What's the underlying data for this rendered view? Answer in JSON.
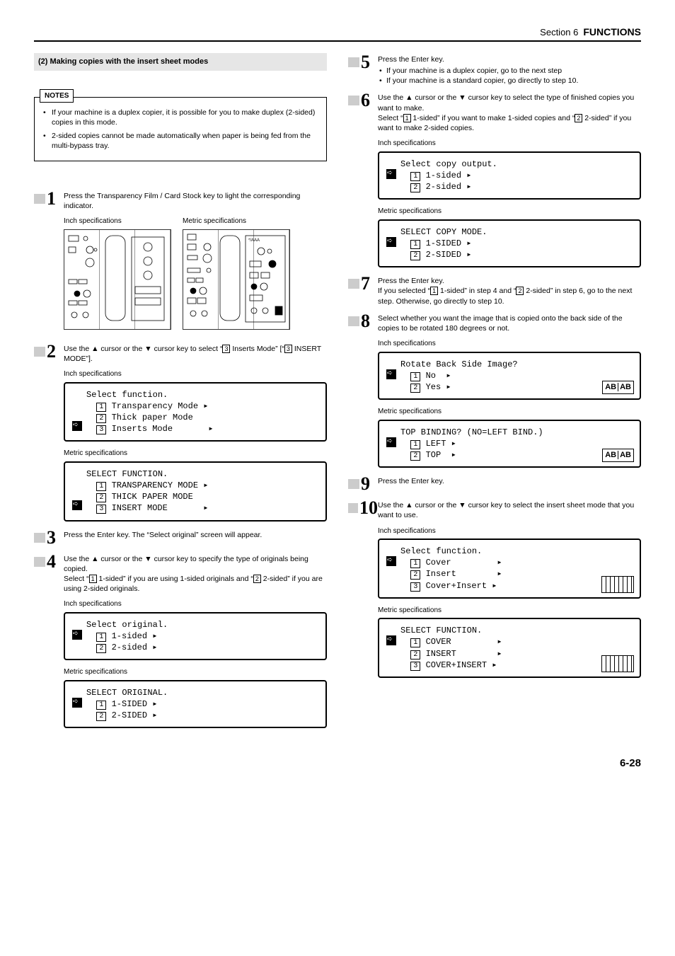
{
  "header": {
    "section": "Section 6",
    "title": "FUNCTIONS"
  },
  "subtitle": "(2) Making copies with the insert sheet modes",
  "notes": {
    "label": "NOTES",
    "items": [
      "If your machine is a duplex copier, it is possible for you to make duplex (2-sided) copies in this mode.",
      "2-sided copies cannot be made automatically when paper is being fed from the multi-bypass tray."
    ]
  },
  "panel_captions": {
    "inch": "Inch specifications",
    "metric": "Metric specifications"
  },
  "steps": {
    "s1": "Press the Transparency Film / Card Stock key to light the corresponding indicator.",
    "s2": {
      "pre": "Use the ▲ cursor or the ▼ cursor key to select “",
      "opt": "3",
      "post": " Inserts Mode” [“",
      "opt2": "3",
      "post2": " INSERT MODE”]."
    },
    "s3": "Press the Enter key. The “Select original” screen will appear.",
    "s4": {
      "line1": "Use the ▲ cursor or the ▼ cursor key to specify the type of originals being copied.",
      "line2a": "Select “",
      "o1": "1",
      "line2b": " 1-sided” if you are using 1-sided originals and “",
      "o2": "2",
      "line2c": " 2-sided” if you are using 2-sided originals."
    },
    "s5": {
      "line1": "Press the Enter key.",
      "b1": "If your machine is a duplex copier, go to the next step",
      "b2": "If your machine is a standard copier, go directly to step 10."
    },
    "s6": {
      "line1": "Use the ▲ cursor or the ▼ cursor key to select the type of finished copies you want to make.",
      "line2a": "Select “",
      "o1": "1",
      "line2b": " 1-sided” if you want to make 1-sided copies and “",
      "o2": "2",
      "line2c": " 2-sided” if you want to make 2-sided copies."
    },
    "s7": {
      "line1": "Press the Enter key.",
      "line2a": "If you selected “",
      "o1": "1",
      "line2b": " 1-sided” in step 4 and “",
      "o2": "2",
      "line2c": " 2-sided” in step 6, go to the next step. Otherwise, go directly to step 10."
    },
    "s8": "Select whether you want the image that is copied onto the back side of the copies to be rotated 180 degrees or not.",
    "s9": "Press the Enter key.",
    "s10": "Use the ▲ cursor or the ▼ cursor key to select the insert sheet mode that you want to use."
  },
  "lcd": {
    "s2_inch": {
      "title": "Select function.",
      "l1": "Transparency Mode ▸",
      "l2": "Thick paper Mode",
      "l3": "Inserts Mode       ▸"
    },
    "s2_metric": {
      "title": "SELECT FUNCTION.",
      "l1": "TRANSPARENCY MODE ▸",
      "l2": "THICK PAPER MODE",
      "l3": "INSERT MODE       ▸"
    },
    "s4_inch": {
      "title": "Select original.",
      "l1": "1-sided ▸",
      "l2": "2-sided ▸"
    },
    "s4_metric": {
      "title": "SELECT ORIGINAL.",
      "l1": "1-SIDED ▸",
      "l2": "2-SIDED ▸"
    },
    "s6_inch": {
      "title": "Select copy output.",
      "l1": "1-sided ▸",
      "l2": "2-sided ▸"
    },
    "s6_metric": {
      "title": "SELECT COPY MODE.",
      "l1": "1-SIDED ▸",
      "l2": "2-SIDED ▸"
    },
    "s8_inch": {
      "title": "Rotate Back Side Image?",
      "l1": "No  ▸",
      "l2": "Yes ▸"
    },
    "s8_metric": {
      "title": "TOP BINDING? (NO=LEFT BIND.)",
      "l1": "LEFT ▸",
      "l2": "TOP  ▸"
    },
    "s10_inch": {
      "title": "Select function.",
      "l1": "Cover         ▸",
      "l2": "Insert        ▸",
      "l3": "Cover+Insert ▸"
    },
    "s10_metric": {
      "title": "SELECT FUNCTION.",
      "l1": "COVER         ▸",
      "l2": "INSERT        ▸",
      "l3": "COVER+INSERT ▸"
    }
  },
  "spec": {
    "inch": "Inch specifications",
    "metric": "Metric specifications"
  },
  "abab": "AB|AB",
  "page": "6-28"
}
